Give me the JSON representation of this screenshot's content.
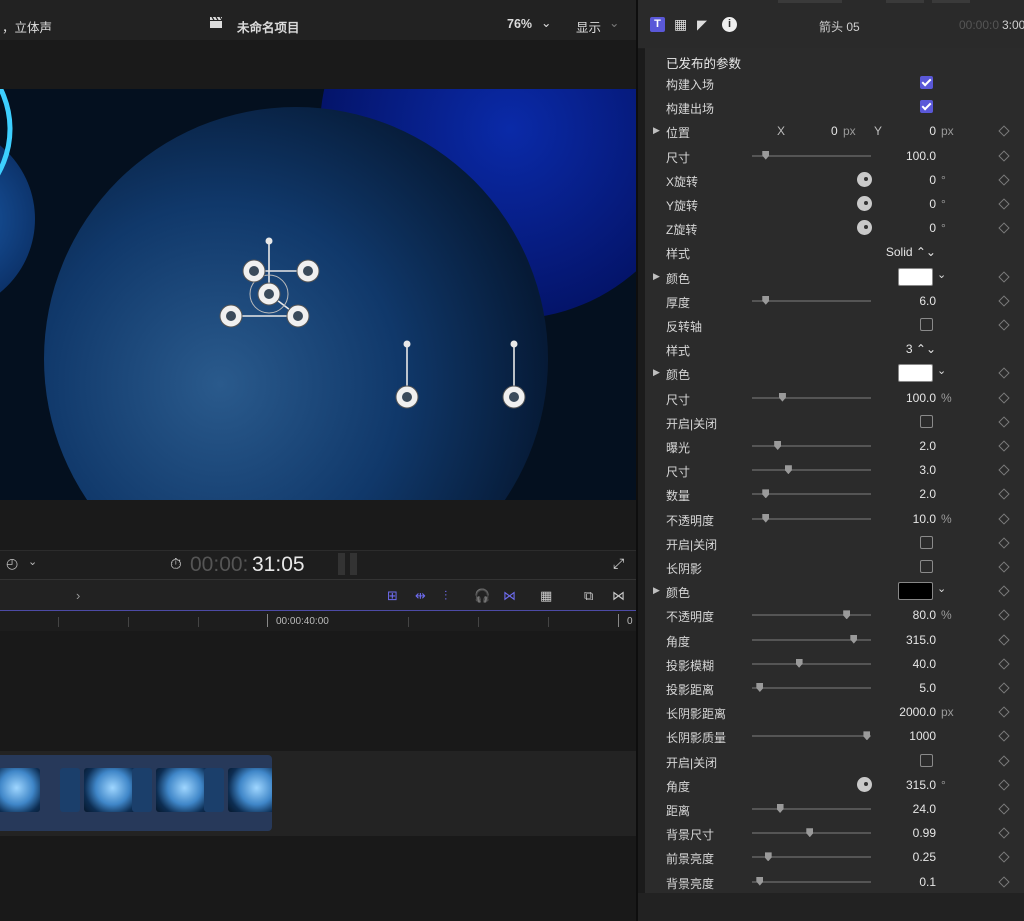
{
  "topbar": {
    "audio_label": "，立体声",
    "project_title": "未命名项目",
    "zoom": "76%",
    "display_label": "显示"
  },
  "transport": {
    "timecode_dim": "00:00:",
    "timecode_bright": "31:05"
  },
  "ruler": {
    "mark1": "00:00:40:00",
    "mark2": "0"
  },
  "inspector": {
    "title": "箭头 05",
    "timecode_dim": "00:00:0",
    "timecode_bright": "3:00",
    "section_title": "已发布的参数",
    "rows": [
      {
        "label": "构建入场",
        "type": "check",
        "checked": true
      },
      {
        "label": "构建出场",
        "type": "check",
        "checked": true
      },
      {
        "label": "位置",
        "type": "xy",
        "x_label": "X",
        "x_value": "0",
        "x_unit": "px",
        "y_label": "Y",
        "y_value": "0",
        "unit": "px",
        "expandable": true
      },
      {
        "label": "尺寸",
        "type": "slider",
        "value": "100.0",
        "level": 0.12
      },
      {
        "label": "X旋转",
        "type": "dial",
        "value": "0",
        "unit": "°"
      },
      {
        "label": "Y旋转",
        "type": "dial",
        "value": "0",
        "unit": "°"
      },
      {
        "label": "Z旋转",
        "type": "dial",
        "value": "0",
        "unit": "°"
      },
      {
        "label": "样式",
        "type": "popup",
        "value": "Solid ⌃⌄"
      },
      {
        "label": "颜色",
        "type": "color",
        "color": "#ffffff",
        "expandable": true
      },
      {
        "label": "厚度",
        "type": "slider",
        "value": "6.0",
        "level": 0.12
      },
      {
        "label": "反转轴",
        "type": "check",
        "checked": false
      },
      {
        "label": "样式",
        "type": "popup",
        "value": "3 ⌃⌄"
      },
      {
        "label": "颜色",
        "type": "color",
        "color": "#ffffff",
        "expandable": true
      },
      {
        "label": "尺寸",
        "type": "slider",
        "value": "100.0",
        "unit": "%",
        "level": 0.26
      },
      {
        "label": "开启|关闭",
        "type": "check",
        "checked": false
      },
      {
        "label": "曝光",
        "type": "slider",
        "value": "2.0",
        "level": 0.22
      },
      {
        "label": "尺寸",
        "type": "slider",
        "value": "3.0",
        "level": 0.31
      },
      {
        "label": "数量",
        "type": "slider",
        "value": "2.0",
        "level": 0.12
      },
      {
        "label": "不透明度",
        "type": "slider",
        "value": "10.0",
        "unit": "%",
        "level": 0.12
      },
      {
        "label": "开启|关闭",
        "type": "check",
        "checked": false
      },
      {
        "label": "长阴影",
        "type": "check",
        "checked": false
      },
      {
        "label": "颜色",
        "type": "color",
        "color": "#000000",
        "expandable": true
      },
      {
        "label": "不透明度",
        "type": "slider",
        "value": "80.0",
        "unit": "%",
        "level": 0.8
      },
      {
        "label": "角度",
        "type": "slider",
        "value": "315.0",
        "level": 0.86
      },
      {
        "label": "投影模糊",
        "type": "slider",
        "value": "40.0",
        "level": 0.4
      },
      {
        "label": "投影距离",
        "type": "slider",
        "value": "5.0",
        "level": 0.07
      },
      {
        "label": "长阴影距离",
        "type": "text",
        "value": "2000.0",
        "unit": "px"
      },
      {
        "label": "长阴影质量",
        "type": "slider",
        "value": "1000",
        "level": 0.97
      },
      {
        "label": "开启|关闭",
        "type": "check",
        "checked": false
      },
      {
        "label": "角度",
        "type": "dial",
        "value": "315.0",
        "unit": "°"
      },
      {
        "label": "距离",
        "type": "slider",
        "value": "24.0",
        "level": 0.24
      },
      {
        "label": "背景尺寸",
        "type": "slider",
        "value": "0.99",
        "level": 0.49
      },
      {
        "label": "前景亮度",
        "type": "slider",
        "value": "0.25",
        "level": 0.14
      },
      {
        "label": "背景亮度",
        "type": "slider",
        "value": "0.1",
        "level": 0.07
      }
    ]
  },
  "colors": {
    "accent": "#5a58d8",
    "timeline_accent": "#6e6cf0"
  }
}
